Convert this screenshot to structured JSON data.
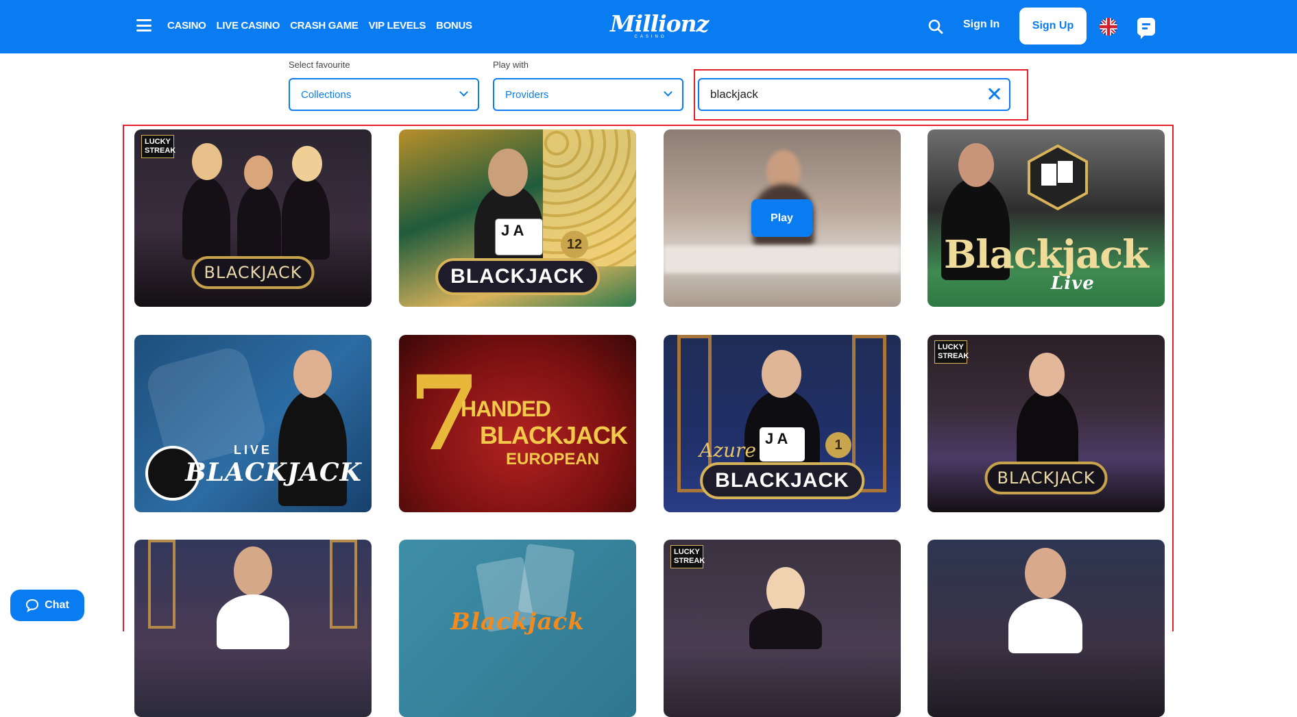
{
  "nav": {
    "items": [
      "CASINO",
      "LIVE CASINO",
      "CRASH GAME",
      "VIP LEVELS",
      "BONUS"
    ]
  },
  "logo": {
    "main": "Millionz",
    "sub": "CASINO"
  },
  "header": {
    "signin_label": "Sign In",
    "signup_label": "Sign Up"
  },
  "filters": {
    "favourite_label": "Select favourite",
    "favourite_value": "Collections",
    "playwith_label": "Play with",
    "playwith_value": "Providers",
    "search_value": "blackjack"
  },
  "games": [
    {
      "title": "BLACKJACK",
      "badge": "LUCKY STREAK"
    },
    {
      "title": "BLACKJACK",
      "number": "12"
    },
    {
      "title": "",
      "play_label": "Play"
    },
    {
      "title": "Blackjack",
      "subtitle": "Live"
    },
    {
      "title": "BLACKJACK",
      "subtitle": "LIVE"
    },
    {
      "number": "7",
      "title": "HANDED",
      "title2": "BLACKJACK",
      "subtitle": "EUROPEAN"
    },
    {
      "title": "BLACKJACK",
      "subtitle": "Azure",
      "number": "1"
    },
    {
      "title": "BLACKJACK",
      "badge": "LUCKY STREAK"
    },
    {
      "title": ""
    },
    {
      "title": "Blackjack"
    },
    {
      "title": "",
      "badge": "LUCKY STREAK"
    },
    {
      "title": ""
    }
  ],
  "chat": {
    "label": "Chat"
  },
  "colors": {
    "brand": "#0a7cf2",
    "highlight": "#e41f2a"
  }
}
